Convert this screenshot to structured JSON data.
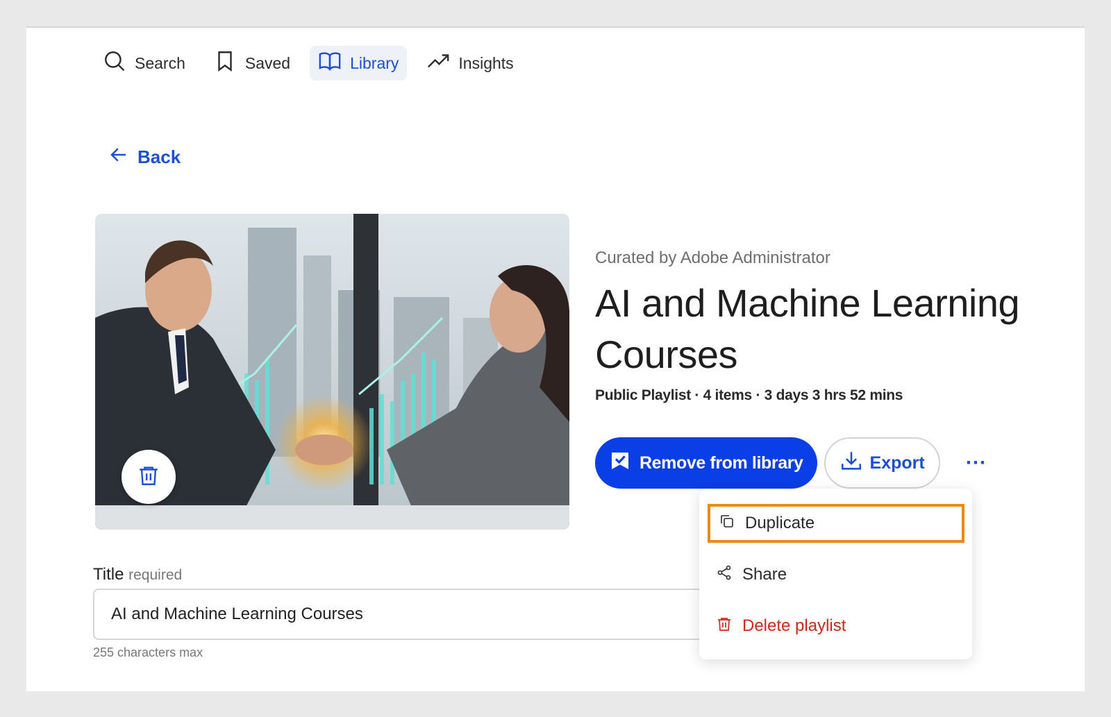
{
  "nav": {
    "items": [
      {
        "label": "Search",
        "icon": "search-icon",
        "active": false
      },
      {
        "label": "Saved",
        "icon": "bookmark-icon",
        "active": false
      },
      {
        "label": "Library",
        "icon": "book-open-icon",
        "active": true
      },
      {
        "label": "Insights",
        "icon": "trending-up-icon",
        "active": false
      }
    ]
  },
  "back": {
    "label": "Back"
  },
  "playlist": {
    "curated_by": "Curated by Adobe Administrator",
    "title": "AI and Machine Learning Courses",
    "meta": "Public Playlist · 4 items · 3 days 3 hrs 52 mins"
  },
  "actions": {
    "remove_label": "Remove from library",
    "export_label": "Export",
    "more_label": "···"
  },
  "menu": {
    "duplicate": "Duplicate",
    "share": "Share",
    "delete": "Delete playlist"
  },
  "form": {
    "title_label": "Title",
    "required_label": "required",
    "title_value": "AI and Machine Learning Courses",
    "hint": "255 characters max"
  },
  "colors": {
    "accent": "#0a3ee6",
    "link": "#1c4fd8",
    "highlight_border": "#ed8a15",
    "danger": "#d3261b"
  }
}
